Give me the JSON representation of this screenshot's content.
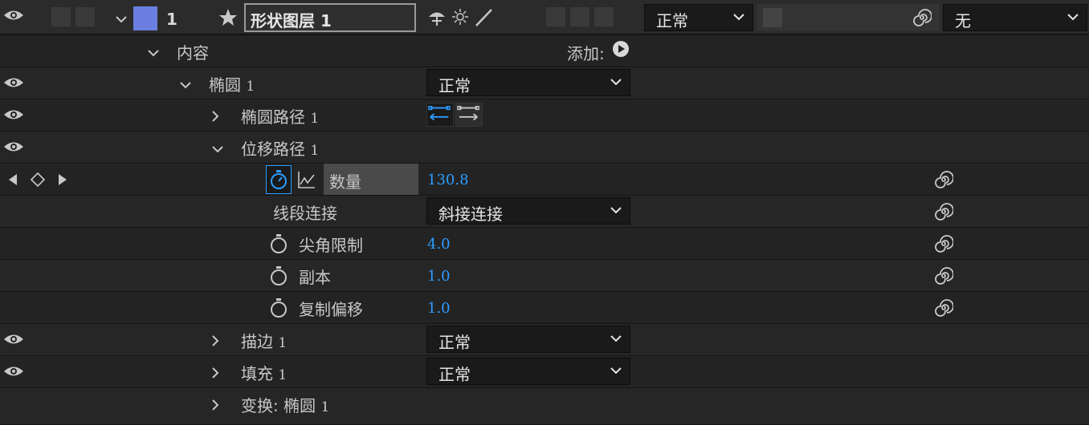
{
  "layer": {
    "number": "1",
    "name": "形状图层 1",
    "color": "#6b7fe0",
    "mode": "正常",
    "trkmat": "无"
  },
  "contents": {
    "label": "内容",
    "add_label": "添加:"
  },
  "ellipse": {
    "label": "椭圆",
    "index": "1",
    "mode": "正常"
  },
  "ellipse_path": {
    "label": "椭圆路径",
    "index": "1"
  },
  "offset_paths": {
    "label": "位移路径",
    "index": "1"
  },
  "amount": {
    "label": "数量",
    "value": "130.8"
  },
  "line_join": {
    "label": "线段连接",
    "value": "斜接连接"
  },
  "miter_limit": {
    "label": "尖角限制",
    "value": "4.0"
  },
  "copies": {
    "label": "副本",
    "value": "1.0"
  },
  "copy_offset": {
    "label": "复制偏移",
    "value": "1.0"
  },
  "stroke": {
    "label": "描边",
    "index": "1",
    "mode": "正常"
  },
  "fill": {
    "label": "填充",
    "index": "1",
    "mode": "正常"
  },
  "transform": {
    "label": "变换: 椭圆",
    "index": "1"
  },
  "icons": {
    "eye": "eye-icon",
    "star": "star-icon",
    "spiral": "expression-spiral-icon",
    "stopwatch": "stopwatch-icon",
    "graph": "graph-icon",
    "play": "play-circle-icon"
  },
  "colors": {
    "accent_blue": "#2d9cff"
  }
}
